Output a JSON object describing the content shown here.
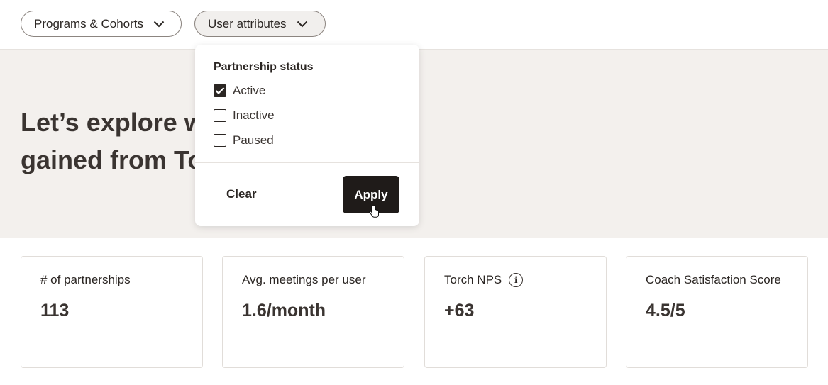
{
  "filters": {
    "programs_label": "Programs & Cohorts",
    "attributes_label": "User attributes"
  },
  "hero": {
    "title_line1": "Let’s explore w",
    "title_line2": "gained from To"
  },
  "dropdown": {
    "heading": "Partnership status",
    "options": [
      {
        "label": "Active",
        "checked": true
      },
      {
        "label": "Inactive",
        "checked": false
      },
      {
        "label": "Paused",
        "checked": false
      }
    ],
    "clear_label": "Clear",
    "apply_label": "Apply"
  },
  "metrics": [
    {
      "label": "# of partnerships",
      "value": "113"
    },
    {
      "label": "Avg. meetings per user",
      "value": "1.6/month"
    },
    {
      "label": "Torch NPS",
      "value": "+63",
      "icon": "info-icon"
    },
    {
      "label": "Coach Satisfaction Score",
      "value": "4.5/5"
    }
  ]
}
